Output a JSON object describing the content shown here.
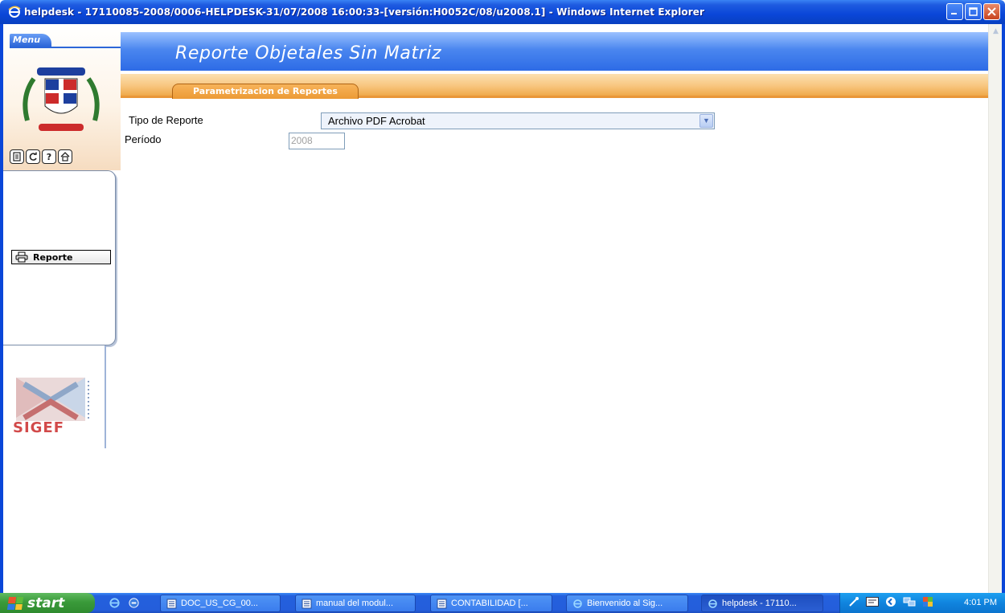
{
  "window": {
    "title": "helpdesk - 17110085-2008/0006-HELPDESK-31/07/2008 16:00:33-[versión:H0052C/08/u2008.1] - Windows Internet Explorer"
  },
  "menu": {
    "tab_label": "Menu",
    "toolbar_icons": [
      "document-icon",
      "refresh-icon",
      "help-icon",
      "home-icon"
    ],
    "items": [
      {
        "label": "Reporte",
        "icon": "printer-icon"
      }
    ],
    "logo_text": "SIGEF"
  },
  "page": {
    "title": "Reporte Objetales Sin Matriz",
    "tab": "Parametrizacion de Reportes"
  },
  "form": {
    "tipo_label": "Tipo de Reporte",
    "tipo_value": "Archivo PDF Acrobat",
    "periodo_label": "Período",
    "periodo_value": "2008"
  },
  "taskbar": {
    "start_label": "start",
    "tasks": [
      {
        "label": "DOC_US_CG_00...",
        "icon": "word-doc-icon"
      },
      {
        "label": "manual del modul...",
        "icon": "word-doc-icon"
      },
      {
        "label": "CONTABILIDAD [...",
        "icon": "word-doc-icon"
      },
      {
        "label": "Bienvenido al Sig...",
        "icon": "ie-icon"
      },
      {
        "label": "helpdesk - 17110...",
        "icon": "ie-icon"
      }
    ],
    "clock": "4:01 PM"
  },
  "colors": {
    "header_blue": "#2d6be6",
    "band_orange": "#f8c680",
    "xp_blue": "#245edb"
  }
}
